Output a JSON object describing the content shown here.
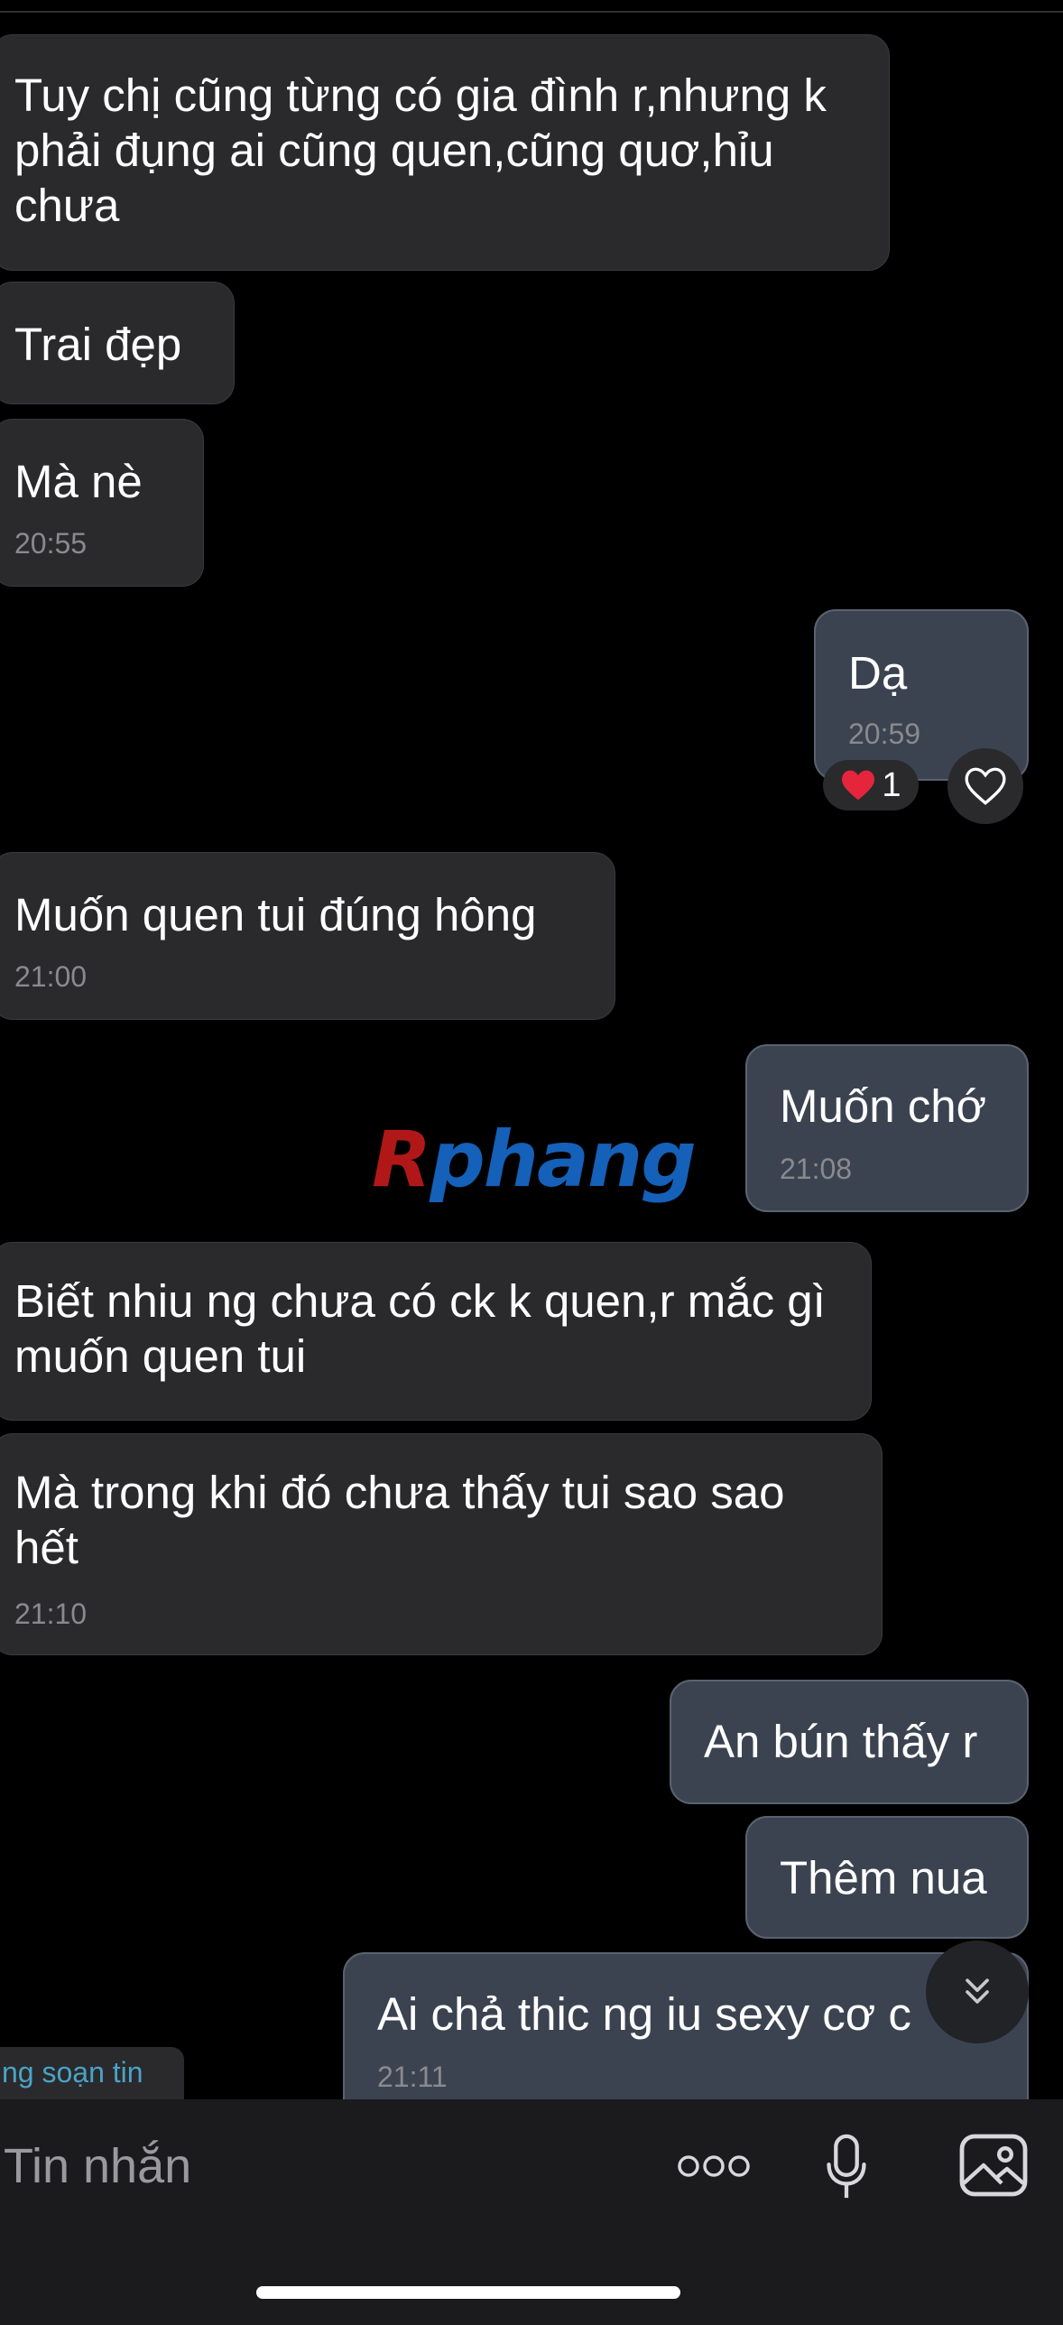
{
  "conversation": {
    "messages": [
      {
        "direction": "incoming",
        "text": "Tuy chị cũng từng có gia đình r,nhưng k phải đụng ai cũng quen,cũng quơ,hỉu chưa",
        "time": ""
      },
      {
        "direction": "incoming",
        "text": "Trai đẹp",
        "time": ""
      },
      {
        "direction": "incoming",
        "text": "Mà nè",
        "time": "20:55"
      },
      {
        "direction": "outgoing",
        "text": "Dạ",
        "time": "20:59",
        "reaction": {
          "emoji": "❤️",
          "count": "1"
        }
      },
      {
        "direction": "incoming",
        "text": "Muốn quen tui đúng hông",
        "time": "21:00"
      },
      {
        "direction": "outgoing",
        "text": "Muốn chớ",
        "time": "21:08"
      },
      {
        "direction": "incoming",
        "text": "Biết nhiu ng chưa có ck k quen,r mắc gì muốn quen tui",
        "time": ""
      },
      {
        "direction": "incoming",
        "text": "Mà trong khi đó chưa thấy tui sao sao hết",
        "time": "21:10"
      },
      {
        "direction": "outgoing",
        "text": "An bún thấy r",
        "time": ""
      },
      {
        "direction": "outgoing",
        "text": "Thêm nua",
        "time": ""
      },
      {
        "direction": "outgoing",
        "text": "Ai chả thic ng iu sexy cơ c",
        "time": "21:11"
      }
    ],
    "typing_indicator": "ng soạn tin"
  },
  "watermark": {
    "first": "R",
    "rest": "phang"
  },
  "composer": {
    "placeholder": "Tin nhắn"
  },
  "icons": {
    "reaction": "heart-emoji",
    "react_button": "heart-outline-icon",
    "scroll": "double-chevron-down-icon",
    "more": "more-dots-icon",
    "mic": "microphone-icon",
    "image": "image-icon"
  },
  "colors": {
    "background": "#000000",
    "incoming_bubble": "#2a2a2c",
    "outgoing_bubble": "#3c4350",
    "timestamp": "#8a8a8e",
    "typing_text": "#4aa3c8",
    "watermark_red": "#b01818",
    "watermark_blue": "#1560b8"
  }
}
